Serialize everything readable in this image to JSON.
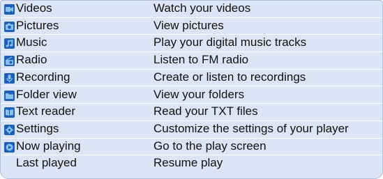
{
  "menu_items": [
    {
      "label": "Videos",
      "description": "Watch your videos",
      "icon": "video-icon"
    },
    {
      "label": "Pictures",
      "description": "View pictures",
      "icon": "camera-icon"
    },
    {
      "label": "Music",
      "description": "Play your digital music tracks",
      "icon": "music-note-icon"
    },
    {
      "label": "Radio",
      "description": "Listen to FM radio",
      "icon": "radio-icon"
    },
    {
      "label": "Recording",
      "description": "Create or listen to recordings",
      "icon": "microphone-icon"
    },
    {
      "label": "Folder view",
      "description": "View your folders",
      "icon": "folder-icon"
    },
    {
      "label": "Text reader",
      "description": "Read your TXT files",
      "icon": "book-icon"
    },
    {
      "label": "Settings",
      "description": "Customize the settings of your player",
      "icon": "gear-icon"
    },
    {
      "label": "Now playing",
      "description": "Go to the play screen",
      "icon": "play-icon"
    },
    {
      "label": "Last played",
      "description": "Resume play",
      "icon": ""
    }
  ],
  "colors": {
    "table_background": "#dbe5f5",
    "row_separator": "#ffffff",
    "icon_base": "#1f5fb6",
    "icon_light": "#8cc0ef"
  }
}
